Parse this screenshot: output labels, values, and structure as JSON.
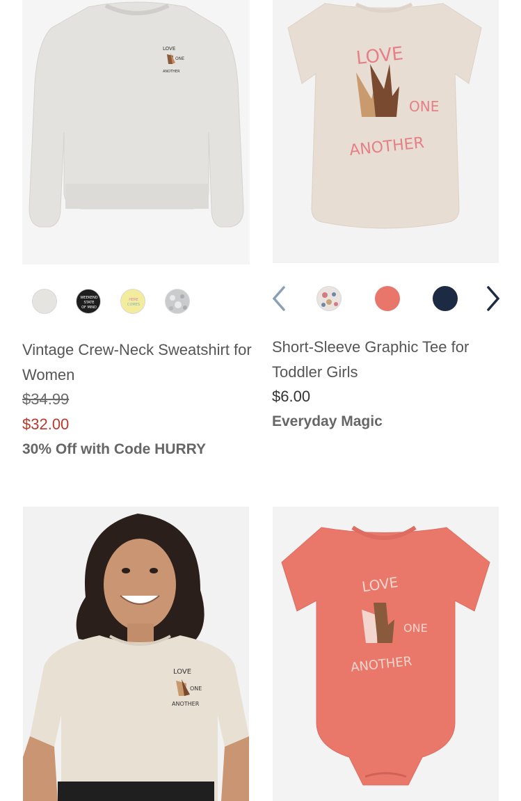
{
  "products": [
    {
      "graphic_text": [
        "LOVE",
        "ONE",
        "ANOTHER"
      ],
      "swatches": [
        {
          "name": "heather-gray",
          "color": "#e6e4e0"
        },
        {
          "name": "black-weekend",
          "color": "#1e1e1e",
          "lettering": "WEEKEND STATE OF MIND"
        },
        {
          "name": "yellow-here-comes",
          "color": "#f3ec9c",
          "lettering": "HERE COMES"
        },
        {
          "name": "floral-gray",
          "color": "#c9cbcc"
        }
      ],
      "title": "Vintage Crew-Neck Sweatshirt for Women",
      "original_price": "$34.99",
      "sale_price": "$32.00",
      "promo": "30% Off with Code HURRY"
    },
    {
      "graphic_text": [
        "LOVE",
        "ONE",
        "ANOTHER"
      ],
      "swatches": [
        {
          "name": "floral-white",
          "color": "#e9e4df"
        },
        {
          "name": "coral",
          "color": "#e9766a"
        },
        {
          "name": "navy",
          "color": "#1c2a44"
        }
      ],
      "title": "Short-Sleeve Graphic Tee for Toddler Girls",
      "price": "$6.00",
      "promo": "Everyday Magic"
    },
    {
      "graphic_text": [
        "LOVE",
        "ONE",
        "ANOTHER"
      ]
    },
    {
      "graphic_text": [
        "LOVE",
        "ONE",
        "ANOTHER"
      ]
    }
  ],
  "colors": {
    "sale_red": "#b83a2c",
    "nav_arrow_inactive": "#8aa0b5",
    "nav_arrow_active": "#1c2a44"
  }
}
